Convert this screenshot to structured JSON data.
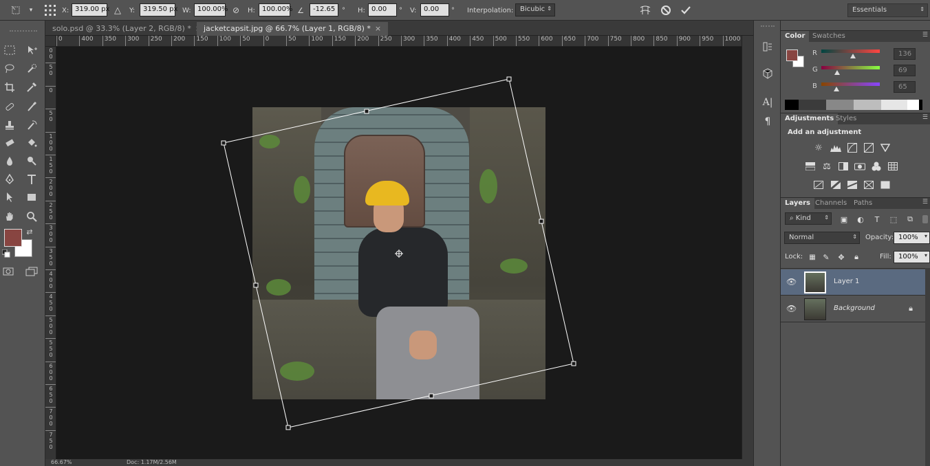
{
  "options_bar": {
    "x_label": "X:",
    "x_value": "319.00 px",
    "y_label": "Y:",
    "y_value": "319.50 px",
    "w_label": "W:",
    "w_value": "100.00%",
    "h_label": "H:",
    "h_value": "100.00%",
    "angle_value": "-12.65",
    "angle_unit": "°",
    "hskew_label": "H:",
    "hskew_value": "0.00",
    "hskew_unit": "°",
    "vskew_label": "V:",
    "vskew_value": "0.00",
    "vskew_unit": "°",
    "interpolation_label": "Interpolation:",
    "interpolation_value": "Bicubic",
    "workspace": "Essentials"
  },
  "tabs": [
    {
      "label": "solo.psd @ 33.3% (Layer 2, RGB/8) *",
      "close": "×"
    },
    {
      "label": "jacketcapsit.jpg @ 66.7% (Layer 1, RGB/8) *",
      "close": "×"
    }
  ],
  "ruler_top": [
    "0",
    "400",
    "350",
    "300",
    "250",
    "200",
    "150",
    "100",
    "50",
    "0",
    "50",
    "100",
    "150",
    "200",
    "250",
    "300",
    "350",
    "400",
    "450",
    "500",
    "550",
    "600",
    "650",
    "700",
    "750",
    "800",
    "850",
    "900",
    "950",
    "1000",
    "1"
  ],
  "ruler_left": [
    "1\n0\n0",
    "5\n0",
    "0",
    "5\n0",
    "1\n0\n0",
    "1\n5\n0",
    "2\n0\n0",
    "2\n5\n0",
    "3\n0\n0",
    "3\n5\n0",
    "4\n0\n0",
    "4\n5\n0",
    "5\n0\n0",
    "5\n5\n0",
    "6\n0\n0",
    "6\n5\n0",
    "7\n0\n0",
    "7\n5\n0"
  ],
  "status": {
    "zoom": "66.67%",
    "doc": "Doc: 1.17M/2.56M"
  },
  "colors": {
    "foreground": "#884541",
    "background": "#ffffff"
  },
  "color_panel": {
    "tabs": [
      "Color",
      "Swatches"
    ],
    "r_label": "R",
    "r_value": "136",
    "g_label": "G",
    "g_value": "69",
    "b_label": "B",
    "b_value": "65"
  },
  "adjustments_panel": {
    "tabs": [
      "Adjustments",
      "Styles"
    ],
    "heading": "Add an adjustment"
  },
  "layers_panel": {
    "tabs": [
      "Layers",
      "Channels",
      "Paths"
    ],
    "filter_kind": "Kind",
    "blend_mode": "Normal",
    "opacity_label": "Opacity:",
    "opacity_value": "100%",
    "lock_label": "Lock:",
    "fill_label": "Fill:",
    "fill_value": "100%",
    "layers": [
      {
        "name": "Layer 1",
        "selected": true
      },
      {
        "name": "Background",
        "selected": false,
        "locked": true
      }
    ]
  },
  "mini_dock": {
    "char_label": "A|",
    "para_label": "¶"
  }
}
